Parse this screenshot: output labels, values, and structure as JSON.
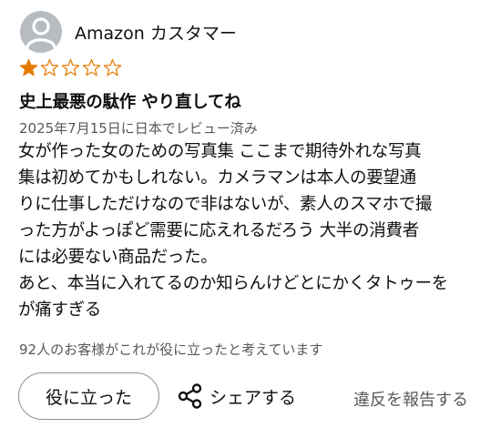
{
  "reviewer": {
    "name": "Amazon カスタマー",
    "avatar_icon": "default-user-icon"
  },
  "rating": {
    "value": 1,
    "max": 5,
    "filled_color": "#e67a00",
    "empty_color": "#e67a00"
  },
  "review": {
    "title": "史上最悪の駄作 やり直してね",
    "date": "2025年7月15日に日本でレビュー済み",
    "body_lines": [
      "女が作った女のための写真集 ここまで期待外れな写真",
      "集は初めてかもしれない。カメラマンは本人の要望通",
      "りに仕事しただけなので非はないが、素人のスマホで撮",
      "った方がよっぽど需要に応えれるだろう 大半の消費者",
      "には必要ない商品だった。",
      "あと、本当に入れてるのか知らんけどとにかくタトゥーを",
      "が痛すぎる"
    ]
  },
  "helpful_count_text": "92人のお客様がこれが役に立ったと考えています",
  "actions": {
    "helpful_label": "役に立った",
    "share_label": "シェアする",
    "share_icon": "share-icon",
    "report_label": "違反を報告する"
  }
}
